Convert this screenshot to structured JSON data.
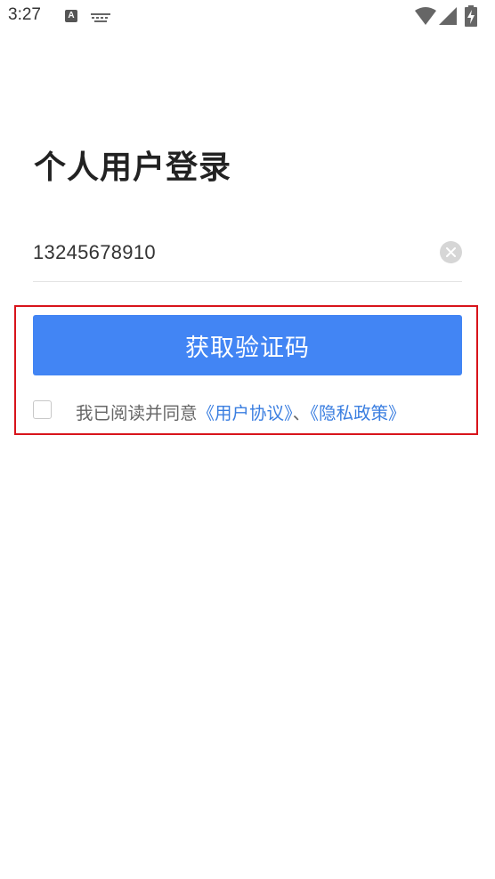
{
  "status_bar": {
    "time": "3:27",
    "notification_icons": [
      "font-a-icon",
      "keyboard-icon"
    ],
    "right_icons": [
      "wifi-icon",
      "signal-icon",
      "battery-charging-icon"
    ]
  },
  "page": {
    "title": "个人用户登录"
  },
  "phone_field": {
    "value": "13245678910"
  },
  "submit": {
    "label": "获取验证码"
  },
  "agreement": {
    "prefix": "我已阅读并同意",
    "user_agreement": "《用户协议》",
    "separator": "、",
    "privacy_policy": "《隐私政策》"
  },
  "colors": {
    "primary": "#4285f4",
    "link": "#3a7ee0",
    "highlight_border": "#d8141b"
  }
}
